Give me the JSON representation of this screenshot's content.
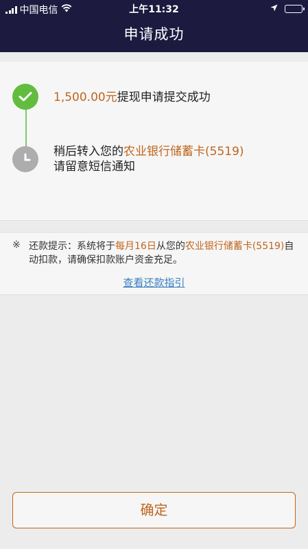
{
  "status_bar": {
    "carrier": "中国电信",
    "time": "上午11:32"
  },
  "nav": {
    "title": "申请成功"
  },
  "steps": [
    {
      "amount": "1,500.00元",
      "text": "提现申请提交成功"
    },
    {
      "line1_prefix": "稍后转入您的",
      "card": "农业银行储蓄卡(5519)",
      "line2": "请留意短信通知"
    }
  ],
  "notice": {
    "mark": "※",
    "prefix": "还款提示：系统将于",
    "date": "每月16日",
    "middle": "从您的",
    "card": "农业银行储蓄卡(5519)",
    "suffix": "自动扣款，请确保扣款账户资金充足。",
    "link": "查看还款指引"
  },
  "confirm_label": "确定",
  "colors": {
    "nav_bg": "#1d1a40",
    "accent": "#c0651c",
    "success": "#62bd3f",
    "pending": "#adadad",
    "link": "#3a7ec0"
  }
}
